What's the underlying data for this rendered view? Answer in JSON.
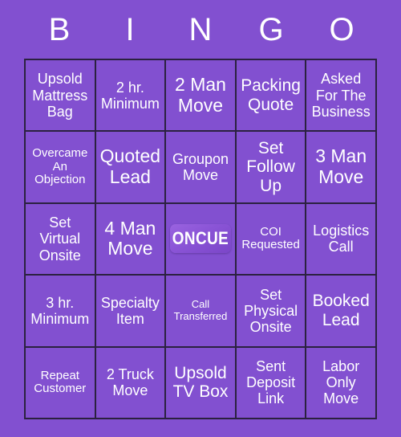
{
  "card": {
    "header_letters": [
      "B",
      "I",
      "N",
      "G",
      "O"
    ],
    "background_color": "#8250d0",
    "grid_line_color": "#2b2140",
    "text_color": "#ffffff"
  },
  "free_space": {
    "logo_text": "ONCUE",
    "logo_gradient_start": "#9a63e0",
    "logo_gradient_end": "#7b46c8"
  },
  "rows": [
    [
      {
        "label": "Upsold Mattress Bag",
        "size": "size-md"
      },
      {
        "label": "2 hr. Minimum",
        "size": "size-md"
      },
      {
        "label": "2 Man Move",
        "size": "size-xl"
      },
      {
        "label": "Packing Quote",
        "size": "size-lg"
      },
      {
        "label": "Asked For The Business",
        "size": "size-md"
      }
    ],
    [
      {
        "label": "Overcame An Objection",
        "size": "size-sm"
      },
      {
        "label": "Quoted Lead",
        "size": "size-xl"
      },
      {
        "label": "Groupon Move",
        "size": "size-md"
      },
      {
        "label": "Set Follow Up",
        "size": "size-lg"
      },
      {
        "label": "3 Man Move",
        "size": "size-xl"
      }
    ],
    [
      {
        "label": "Set Virtual Onsite",
        "size": "size-md"
      },
      {
        "label": "4 Man Move",
        "size": "size-xl"
      },
      {
        "label": "ONCUE",
        "size": "free"
      },
      {
        "label": "COI Requested",
        "size": "size-sm"
      },
      {
        "label": "Logistics Call",
        "size": "size-md"
      }
    ],
    [
      {
        "label": "3 hr. Minimum",
        "size": "size-md"
      },
      {
        "label": "Specialty Item",
        "size": "size-md"
      },
      {
        "label": "Call Transferred",
        "size": "size-xs"
      },
      {
        "label": "Set Physical Onsite",
        "size": "size-md"
      },
      {
        "label": "Booked Lead",
        "size": "size-lg"
      }
    ],
    [
      {
        "label": "Repeat Customer",
        "size": "size-sm"
      },
      {
        "label": "2 Truck Move",
        "size": "size-md"
      },
      {
        "label": "Upsold TV Box",
        "size": "size-lg"
      },
      {
        "label": "Sent Deposit Link",
        "size": "size-md"
      },
      {
        "label": "Labor Only Move",
        "size": "size-md"
      }
    ]
  ]
}
